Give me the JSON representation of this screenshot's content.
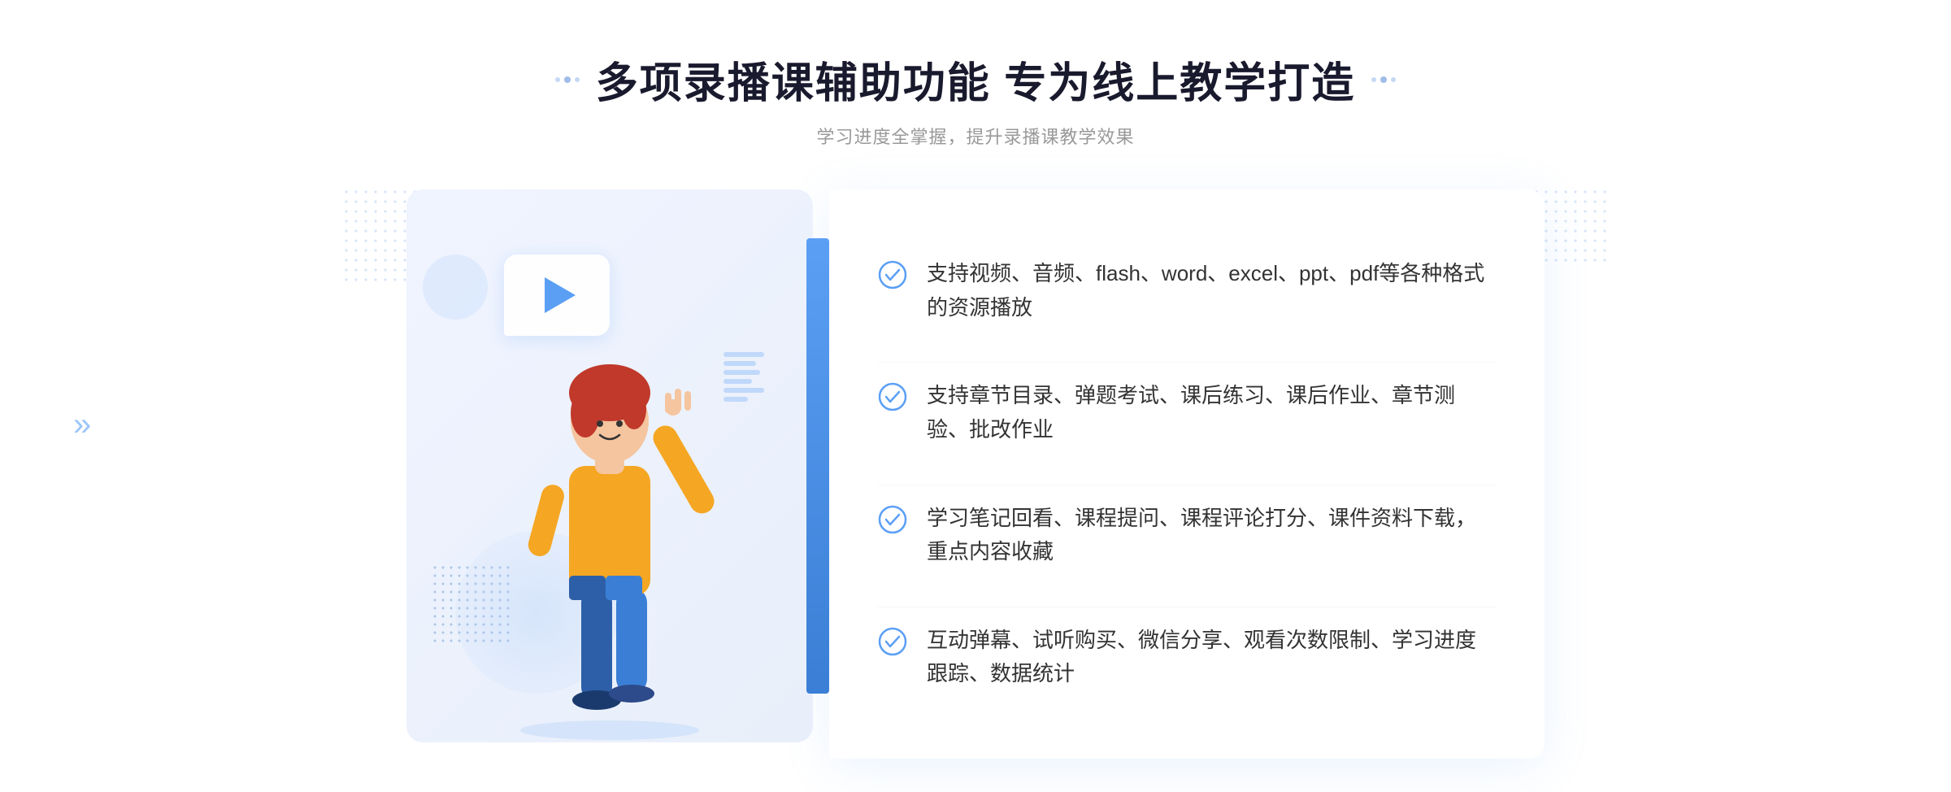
{
  "page": {
    "background": "#ffffff"
  },
  "header": {
    "title": "多项录播课辅助功能 专为线上教学打造",
    "subtitle": "学习进度全掌握，提升录播课教学效果",
    "decorator_left": "⁚",
    "decorator_right": "⁚"
  },
  "features": [
    {
      "id": 1,
      "text": "支持视频、音频、flash、word、excel、ppt、pdf等各种格式的资源播放"
    },
    {
      "id": 2,
      "text": "支持章节目录、弹题考试、课后练习、课后作业、章节测验、批改作业"
    },
    {
      "id": 3,
      "text": "学习笔记回看、课程提问、课程评论打分、课件资料下载，重点内容收藏"
    },
    {
      "id": 4,
      "text": "互动弹幕、试听购买、微信分享、观看次数限制、学习进度跟踪、数据统计"
    }
  ],
  "icons": {
    "check": "check-circle-icon",
    "play": "play-icon",
    "chevron": "chevron-right-icon"
  },
  "colors": {
    "primary": "#5b9ff5",
    "primary_dark": "#3a7fd5",
    "text_dark": "#1a1a2e",
    "text_light": "#999999",
    "text_body": "#333333",
    "bg_light": "#f0f4ff",
    "white": "#ffffff"
  }
}
